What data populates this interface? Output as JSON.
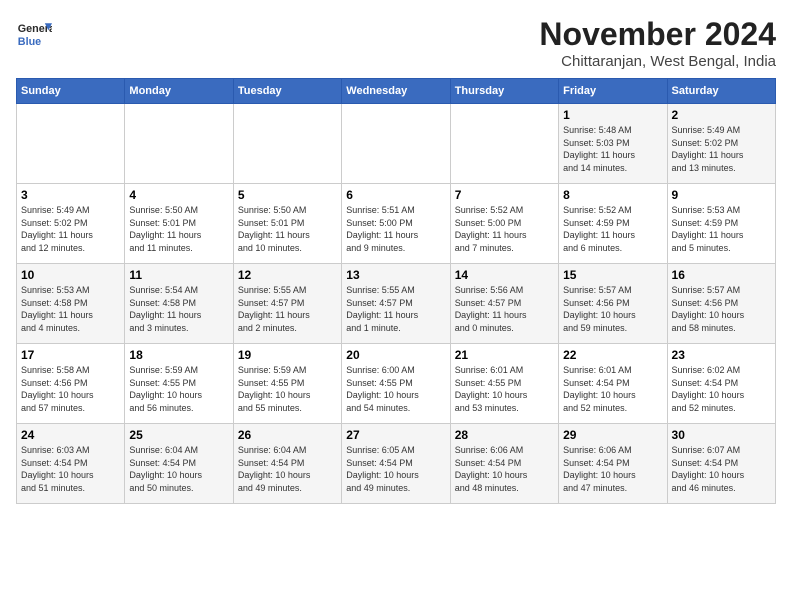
{
  "logo": {
    "line1": "General",
    "line2": "Blue"
  },
  "title": "November 2024",
  "location": "Chittaranjan, West Bengal, India",
  "days_header": [
    "Sunday",
    "Monday",
    "Tuesday",
    "Wednesday",
    "Thursday",
    "Friday",
    "Saturday"
  ],
  "weeks": [
    [
      {
        "day": "",
        "info": ""
      },
      {
        "day": "",
        "info": ""
      },
      {
        "day": "",
        "info": ""
      },
      {
        "day": "",
        "info": ""
      },
      {
        "day": "",
        "info": ""
      },
      {
        "day": "1",
        "info": "Sunrise: 5:48 AM\nSunset: 5:03 PM\nDaylight: 11 hours\nand 14 minutes."
      },
      {
        "day": "2",
        "info": "Sunrise: 5:49 AM\nSunset: 5:02 PM\nDaylight: 11 hours\nand 13 minutes."
      }
    ],
    [
      {
        "day": "3",
        "info": "Sunrise: 5:49 AM\nSunset: 5:02 PM\nDaylight: 11 hours\nand 12 minutes."
      },
      {
        "day": "4",
        "info": "Sunrise: 5:50 AM\nSunset: 5:01 PM\nDaylight: 11 hours\nand 11 minutes."
      },
      {
        "day": "5",
        "info": "Sunrise: 5:50 AM\nSunset: 5:01 PM\nDaylight: 11 hours\nand 10 minutes."
      },
      {
        "day": "6",
        "info": "Sunrise: 5:51 AM\nSunset: 5:00 PM\nDaylight: 11 hours\nand 9 minutes."
      },
      {
        "day": "7",
        "info": "Sunrise: 5:52 AM\nSunset: 5:00 PM\nDaylight: 11 hours\nand 7 minutes."
      },
      {
        "day": "8",
        "info": "Sunrise: 5:52 AM\nSunset: 4:59 PM\nDaylight: 11 hours\nand 6 minutes."
      },
      {
        "day": "9",
        "info": "Sunrise: 5:53 AM\nSunset: 4:59 PM\nDaylight: 11 hours\nand 5 minutes."
      }
    ],
    [
      {
        "day": "10",
        "info": "Sunrise: 5:53 AM\nSunset: 4:58 PM\nDaylight: 11 hours\nand 4 minutes."
      },
      {
        "day": "11",
        "info": "Sunrise: 5:54 AM\nSunset: 4:58 PM\nDaylight: 11 hours\nand 3 minutes."
      },
      {
        "day": "12",
        "info": "Sunrise: 5:55 AM\nSunset: 4:57 PM\nDaylight: 11 hours\nand 2 minutes."
      },
      {
        "day": "13",
        "info": "Sunrise: 5:55 AM\nSunset: 4:57 PM\nDaylight: 11 hours\nand 1 minute."
      },
      {
        "day": "14",
        "info": "Sunrise: 5:56 AM\nSunset: 4:57 PM\nDaylight: 11 hours\nand 0 minutes."
      },
      {
        "day": "15",
        "info": "Sunrise: 5:57 AM\nSunset: 4:56 PM\nDaylight: 10 hours\nand 59 minutes."
      },
      {
        "day": "16",
        "info": "Sunrise: 5:57 AM\nSunset: 4:56 PM\nDaylight: 10 hours\nand 58 minutes."
      }
    ],
    [
      {
        "day": "17",
        "info": "Sunrise: 5:58 AM\nSunset: 4:56 PM\nDaylight: 10 hours\nand 57 minutes."
      },
      {
        "day": "18",
        "info": "Sunrise: 5:59 AM\nSunset: 4:55 PM\nDaylight: 10 hours\nand 56 minutes."
      },
      {
        "day": "19",
        "info": "Sunrise: 5:59 AM\nSunset: 4:55 PM\nDaylight: 10 hours\nand 55 minutes."
      },
      {
        "day": "20",
        "info": "Sunrise: 6:00 AM\nSunset: 4:55 PM\nDaylight: 10 hours\nand 54 minutes."
      },
      {
        "day": "21",
        "info": "Sunrise: 6:01 AM\nSunset: 4:55 PM\nDaylight: 10 hours\nand 53 minutes."
      },
      {
        "day": "22",
        "info": "Sunrise: 6:01 AM\nSunset: 4:54 PM\nDaylight: 10 hours\nand 52 minutes."
      },
      {
        "day": "23",
        "info": "Sunrise: 6:02 AM\nSunset: 4:54 PM\nDaylight: 10 hours\nand 52 minutes."
      }
    ],
    [
      {
        "day": "24",
        "info": "Sunrise: 6:03 AM\nSunset: 4:54 PM\nDaylight: 10 hours\nand 51 minutes."
      },
      {
        "day": "25",
        "info": "Sunrise: 6:04 AM\nSunset: 4:54 PM\nDaylight: 10 hours\nand 50 minutes."
      },
      {
        "day": "26",
        "info": "Sunrise: 6:04 AM\nSunset: 4:54 PM\nDaylight: 10 hours\nand 49 minutes."
      },
      {
        "day": "27",
        "info": "Sunrise: 6:05 AM\nSunset: 4:54 PM\nDaylight: 10 hours\nand 49 minutes."
      },
      {
        "day": "28",
        "info": "Sunrise: 6:06 AM\nSunset: 4:54 PM\nDaylight: 10 hours\nand 48 minutes."
      },
      {
        "day": "29",
        "info": "Sunrise: 6:06 AM\nSunset: 4:54 PM\nDaylight: 10 hours\nand 47 minutes."
      },
      {
        "day": "30",
        "info": "Sunrise: 6:07 AM\nSunset: 4:54 PM\nDaylight: 10 hours\nand 46 minutes."
      }
    ]
  ]
}
